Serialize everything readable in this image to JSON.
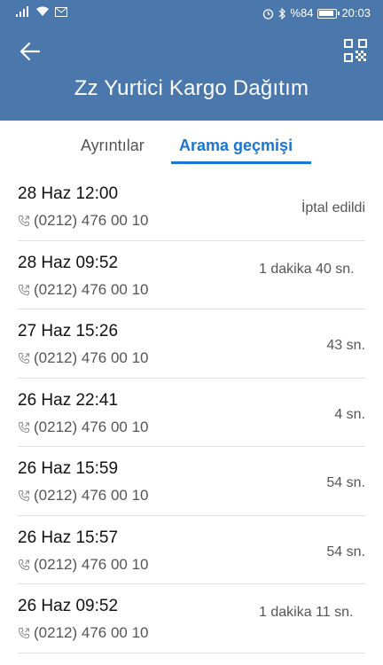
{
  "status_bar": {
    "battery_text": "%84",
    "battery_level": 0.84,
    "time": "20:03"
  },
  "header": {
    "title": "Zz Yurtici Kargo Dağıtım",
    "background_color": "#4a78ad"
  },
  "tabs": [
    {
      "label": "Ayrıntılar",
      "active": false
    },
    {
      "label": "Arama geçmişi",
      "active": true
    }
  ],
  "accent_color": "#1976d2",
  "calls": [
    {
      "date": "28 Haz 12:00",
      "number": "(0212) 476 00 10",
      "duration": "İptal edildi"
    },
    {
      "date": "28 Haz 09:52",
      "number": "(0212) 476 00 10",
      "duration": "1 dakika 40 sn."
    },
    {
      "date": "27 Haz 15:26",
      "number": "(0212) 476 00 10",
      "duration": "43 sn."
    },
    {
      "date": "26 Haz 22:41",
      "number": "(0212) 476 00 10",
      "duration": "4 sn."
    },
    {
      "date": "26 Haz 15:59",
      "number": "(0212) 476 00 10",
      "duration": "54 sn."
    },
    {
      "date": "26 Haz 15:57",
      "number": "(0212) 476 00 10",
      "duration": "54 sn."
    },
    {
      "date": "26 Haz 09:52",
      "number": "(0212) 476 00 10",
      "duration": "1 dakika 11 sn."
    }
  ]
}
